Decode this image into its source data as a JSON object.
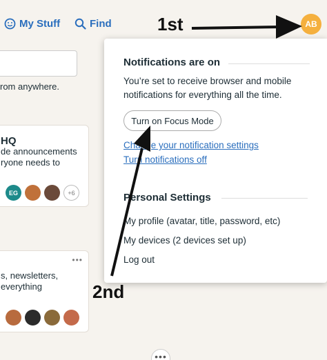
{
  "nav": {
    "my_stuff": "My Stuff",
    "find": "Find",
    "avatar_initials": "AB"
  },
  "home": {
    "search_hint": "rom anywhere.",
    "card1": {
      "title": "HQ",
      "lines": [
        "de announcements",
        "ryone needs to"
      ],
      "people": [
        {
          "initials": "EG",
          "color": "#1d8a8a"
        },
        {
          "initials": "",
          "color": "#c0713a"
        },
        {
          "initials": "",
          "color": "#6b4a3a"
        },
        {
          "initials": "+6",
          "color": ""
        }
      ]
    },
    "card2": {
      "lines": [
        "s, newsletters,",
        "everything"
      ],
      "people": [
        {
          "initials": "",
          "color": "#b86b3e"
        },
        {
          "initials": "",
          "color": "#2b2b2b"
        },
        {
          "initials": "",
          "color": "#8a6a3a"
        },
        {
          "initials": "",
          "color": "#c46a4a"
        }
      ]
    }
  },
  "panel": {
    "notifications_heading": "Notifications are on",
    "notifications_description": "You’re set to receive browser and mobile notifications for everything all the time.",
    "focus_button": "Turn on Focus Mode",
    "change_settings_link": "Change your notification settings",
    "turn_off_link": "Turn notifications off",
    "personal_heading": "Personal Settings",
    "items": [
      "My profile (avatar, title, password, etc)",
      "My devices (2 devices set up)",
      "Log out"
    ]
  },
  "annotations": {
    "first": "1st",
    "second": "2nd"
  }
}
